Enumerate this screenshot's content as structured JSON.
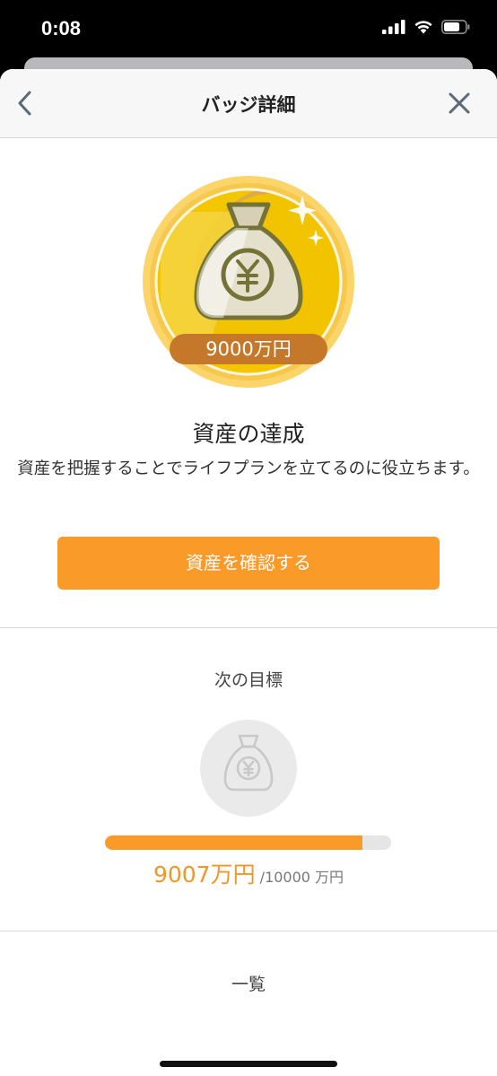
{
  "status_bar": {
    "time": "0:08"
  },
  "nav": {
    "title": "バッジ詳細",
    "back_icon": "chevron-left-icon",
    "close_icon": "close-icon"
  },
  "badge": {
    "amount_label": "9000万円",
    "icon": "money-bag-yen-icon"
  },
  "achievement": {
    "title": "資産の達成",
    "description": "資産を把握することでライフプランを立てるのに役立ちます。"
  },
  "confirm_button": {
    "label": "資産を確認する"
  },
  "next_goal": {
    "label": "次の目標",
    "current_value": "9007",
    "current_unit": "万円",
    "goal_text": "/10000 万円",
    "progress_fraction": 0.9007
  },
  "list": {
    "label": "一覧"
  },
  "colors": {
    "accent": "#f99a29",
    "badge_gold": "#f3c600",
    "badge_ribbon": "#c6782a"
  }
}
